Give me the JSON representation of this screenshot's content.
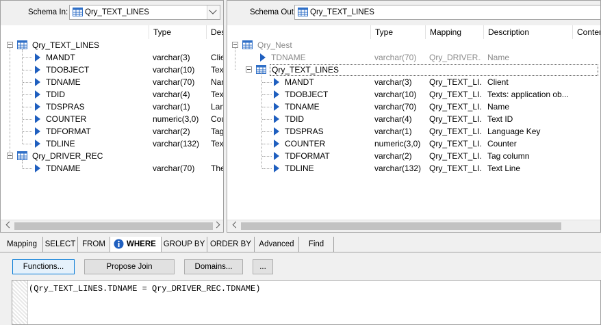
{
  "left": {
    "schema_label": "Schema In:",
    "schema_value": "Qry_TEXT_LINES",
    "headers": [
      "Type",
      "Des"
    ],
    "tree": [
      {
        "name": "Qry_TEXT_LINES",
        "kind": "table",
        "children": [
          {
            "name": "MANDT",
            "type": "varchar(3)",
            "desc": "Clie"
          },
          {
            "name": "TDOBJECT",
            "type": "varchar(10)",
            "desc": "Tex"
          },
          {
            "name": "TDNAME",
            "type": "varchar(70)",
            "desc": "Nar"
          },
          {
            "name": "TDID",
            "type": "varchar(4)",
            "desc": "Tex"
          },
          {
            "name": "TDSPRAS",
            "type": "varchar(1)",
            "desc": "Lan"
          },
          {
            "name": "COUNTER",
            "type": "numeric(3,0)",
            "desc": "Cou"
          },
          {
            "name": "TDFORMAT",
            "type": "varchar(2)",
            "desc": "Tag"
          },
          {
            "name": "TDLINE",
            "type": "varchar(132)",
            "desc": "Tex"
          }
        ]
      },
      {
        "name": "Qry_DRIVER_REC",
        "kind": "table",
        "children": [
          {
            "name": "TDNAME",
            "type": "varchar(70)",
            "desc": "The"
          }
        ]
      }
    ]
  },
  "right": {
    "schema_label": "Schema Out:",
    "schema_value": "Qry_TEXT_LINES",
    "headers": [
      "Type",
      "Mapping",
      "Description",
      "Conten"
    ],
    "root": "Qry_Nest",
    "root_child": {
      "name": "TDNAME",
      "type": "varchar(70)",
      "mapping": "Qry_DRIVER...",
      "desc": "Name"
    },
    "nested": "Qry_TEXT_LINES",
    "columns": [
      {
        "name": "MANDT",
        "type": "varchar(3)",
        "mapping": "Qry_TEXT_LI...",
        "desc": "Client"
      },
      {
        "name": "TDOBJECT",
        "type": "varchar(10)",
        "mapping": "Qry_TEXT_LI...",
        "desc": "Texts: application ob..."
      },
      {
        "name": "TDNAME",
        "type": "varchar(70)",
        "mapping": "Qry_TEXT_LI...",
        "desc": "Name"
      },
      {
        "name": "TDID",
        "type": "varchar(4)",
        "mapping": "Qry_TEXT_LI...",
        "desc": "Text ID"
      },
      {
        "name": "TDSPRAS",
        "type": "varchar(1)",
        "mapping": "Qry_TEXT_LI...",
        "desc": "Language Key"
      },
      {
        "name": "COUNTER",
        "type": "numeric(3,0)",
        "mapping": "Qry_TEXT_LI...",
        "desc": "Counter"
      },
      {
        "name": "TDFORMAT",
        "type": "varchar(2)",
        "mapping": "Qry_TEXT_LI...",
        "desc": "Tag column"
      },
      {
        "name": "TDLINE",
        "type": "varchar(132)",
        "mapping": "Qry_TEXT_LI...",
        "desc": "Text Line"
      }
    ]
  },
  "tabs": [
    "Mapping",
    "SELECT",
    "FROM",
    "WHERE",
    "GROUP BY",
    "ORDER BY",
    "Advanced",
    "Find"
  ],
  "active_tab": "WHERE",
  "buttons": {
    "functions": "Functions...",
    "propose_join": "Propose Join",
    "domains": "Domains...",
    "more": "..."
  },
  "where_clause": "(Qry_TEXT_LINES.TDNAME = Qry_DRIVER_REC.TDNAME)",
  "icons": {
    "table": "table-grid-icon",
    "column": "column-arrow-icon",
    "info": "info-icon",
    "dropdown": "chevron-down-icon"
  },
  "colors": {
    "arrow": "#1f5fbf",
    "table_icon": "#2f6fc7",
    "info": "#1f5fbf"
  }
}
